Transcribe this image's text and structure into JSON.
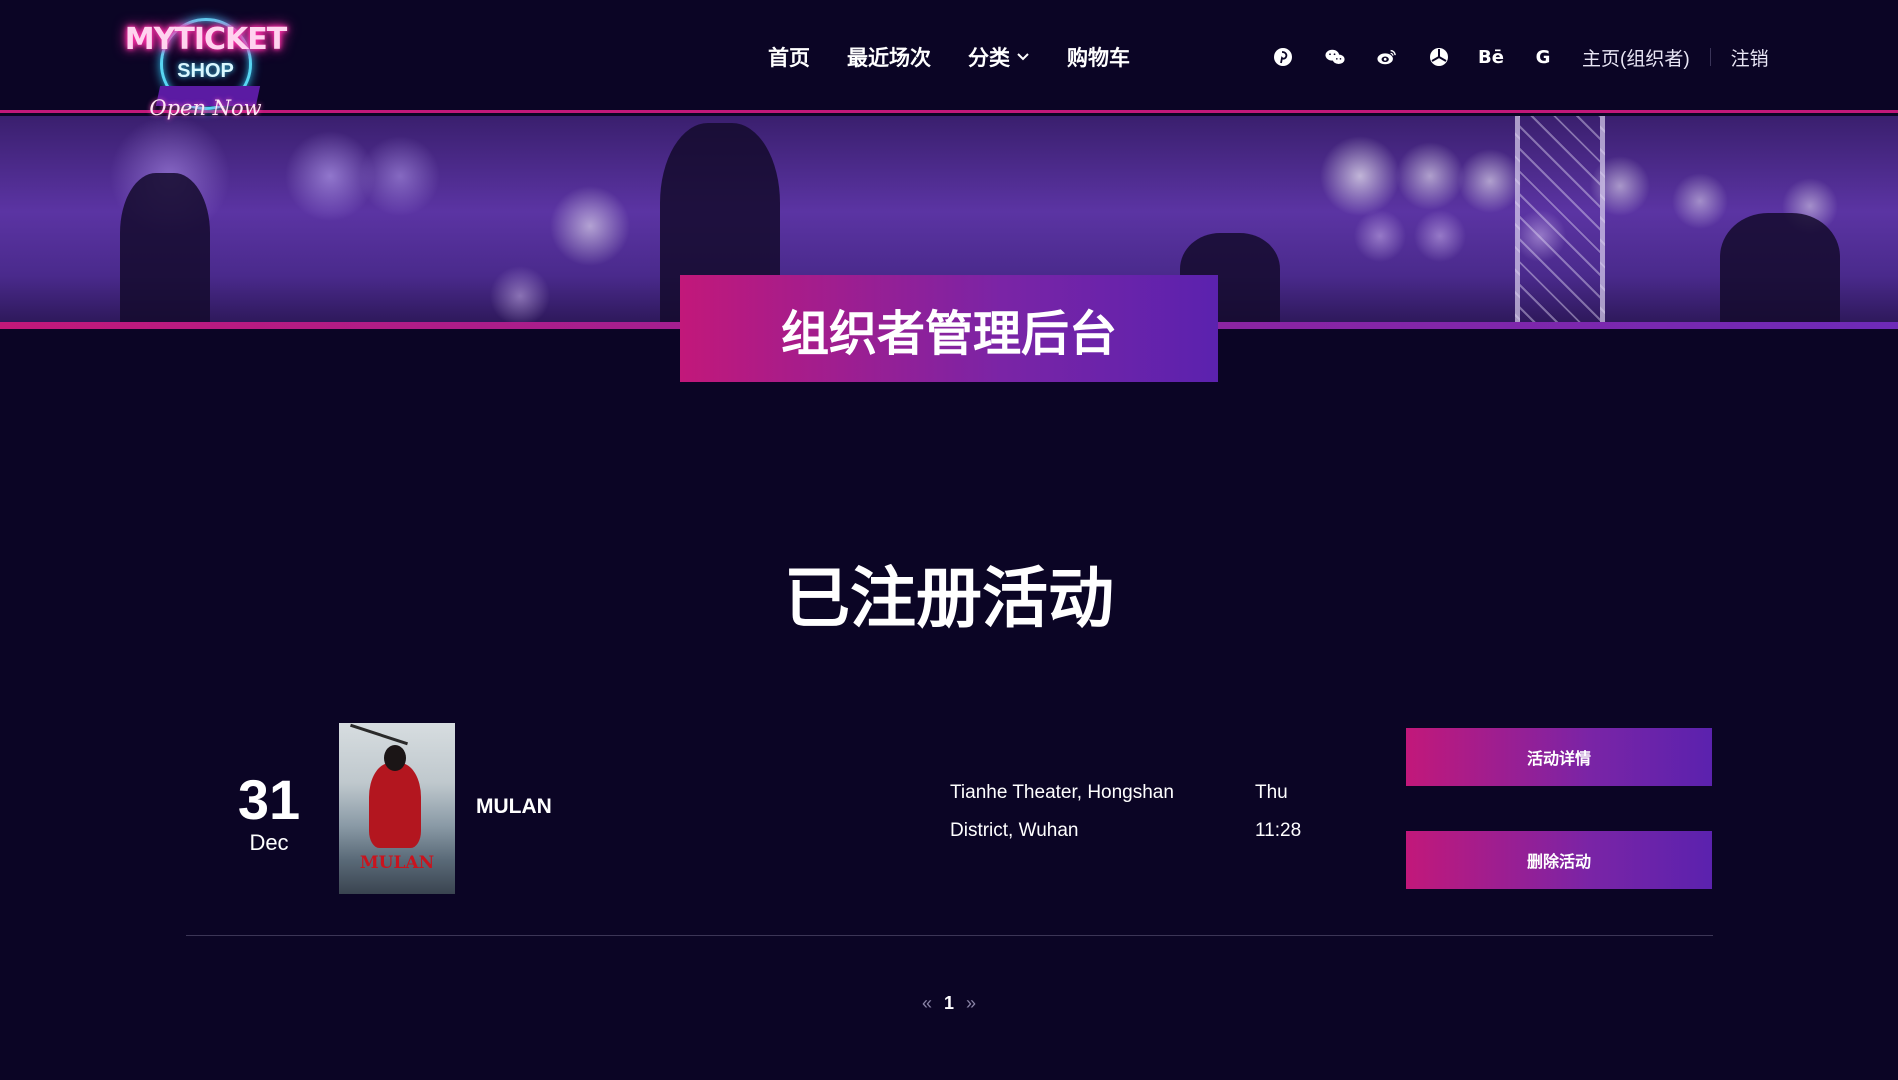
{
  "logo": {
    "brand": "MYTICKET",
    "shop": "SHOP",
    "tagline": "Open Now"
  },
  "nav": {
    "items": [
      {
        "label": "首页"
      },
      {
        "label": "最近场次"
      },
      {
        "label": "分类"
      },
      {
        "label": "购物车"
      }
    ]
  },
  "social": {
    "icons": [
      "pinterest-icon",
      "wechat-icon",
      "weibo-icon",
      "yelp-icon",
      "behance-icon",
      "google-icon"
    ],
    "behance_text": "Bē",
    "google_text": "G"
  },
  "user_links": {
    "home": "主页(组织者)",
    "logout": "注销"
  },
  "hero": {
    "title": "组织者管理后台"
  },
  "section": {
    "title": "已注册活动"
  },
  "events": [
    {
      "day": "31",
      "month": "Dec",
      "poster_title": "MULAN",
      "name": "MULAN",
      "venue": "Tianhe Theater, Hongshan District, Wuhan",
      "weekday": "Thu",
      "time": "11:28",
      "details_button": "活动详情",
      "delete_button": "删除活动"
    }
  ],
  "pagination": {
    "prev": "«",
    "current": "1",
    "next": "»"
  },
  "colors": {
    "background": "#0b0525",
    "accent_pink": "#c2187a",
    "accent_purple": "#5b22ae"
  }
}
